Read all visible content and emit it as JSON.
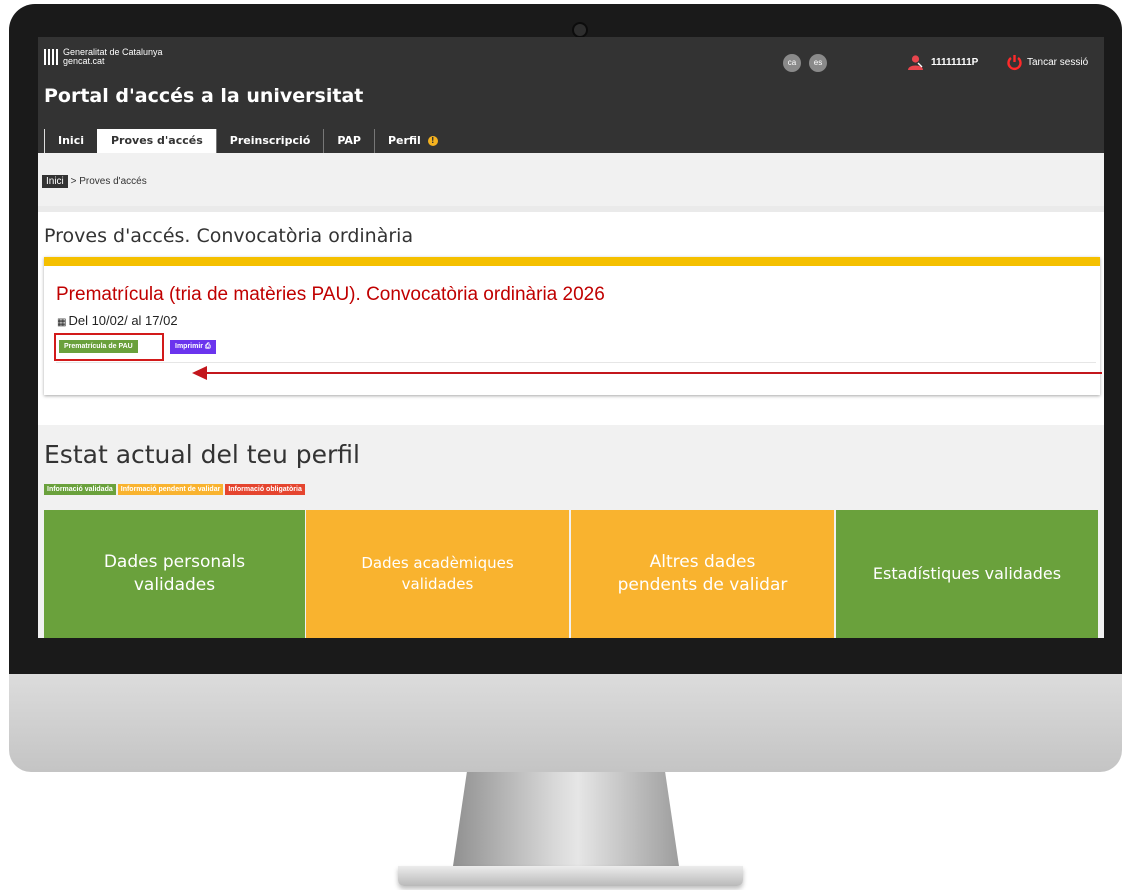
{
  "header": {
    "org_name": "Generalitat de Catalunya",
    "org_site": "gencat.cat",
    "languages": [
      "ca",
      "es"
    ],
    "user_id": "11111111P",
    "logout_label": "Tancar sessió",
    "portal_title": "Portal d'accés a la universitat"
  },
  "nav": {
    "tabs": [
      {
        "label": "Inici",
        "active": false
      },
      {
        "label": "Proves d'accés",
        "active": true
      },
      {
        "label": "Preinscripció",
        "active": false
      },
      {
        "label": "PAP",
        "active": false
      },
      {
        "label": "Perfil",
        "active": false
      }
    ],
    "perfil_alert": "!"
  },
  "breadcrumb": {
    "home": "Inici",
    "separator": ">",
    "current": "Proves d'accés"
  },
  "section": {
    "title": "Proves d'accés. Convocatòria ordinària"
  },
  "card": {
    "title": "Prematrícula (tria de matèries PAU). Convocatòria ordinària 2026",
    "date": "Del 10/02/ al 17/02",
    "button_primary": "Prematrícula de PAU",
    "button_print": "Imprimir",
    "top_color": "#f5c000"
  },
  "profile": {
    "title": "Estat actual del teu perfil",
    "legend": [
      {
        "label": "Informació validada",
        "color": "#6aa13c"
      },
      {
        "label": "Informació pendent de validar",
        "color": "#f9b32f"
      },
      {
        "label": "Informació obligatòria",
        "color": "#e5452f"
      }
    ],
    "tiles": [
      {
        "label": "Dades personals\nvalidades",
        "color": "#6aa13c"
      },
      {
        "label": "Dades acadèmiques\nvalidades",
        "color": "#f9b32f"
      },
      {
        "label": "Altres dades\npendents de validar",
        "color": "#f9b32f"
      },
      {
        "label": "Estadístiques validades",
        "color": "#6aa13c"
      }
    ]
  },
  "annotation": {
    "highlight_color": "#d21a1a",
    "arrow_color": "#c3161c"
  }
}
